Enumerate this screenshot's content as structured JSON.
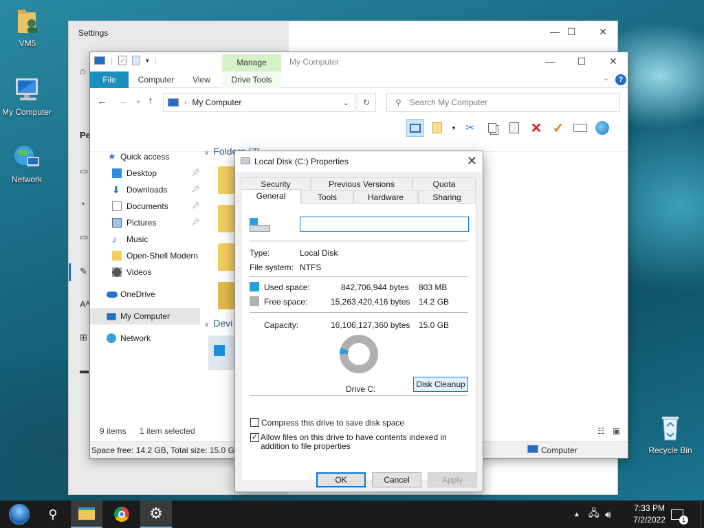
{
  "desktop": {
    "icons": [
      {
        "label": "VM5"
      },
      {
        "label": "My Computer"
      },
      {
        "label": "Network"
      },
      {
        "label": "Recycle Bin"
      }
    ]
  },
  "settings": {
    "title": "Settings",
    "partial_heading": "Pe"
  },
  "explorer": {
    "title": "My Computer",
    "manage_label": "Manage",
    "tabs": {
      "file": "File",
      "computer": "Computer",
      "view": "View",
      "drive_tools": "Drive Tools"
    },
    "address": "My Computer",
    "search_placeholder": "Search My Computer",
    "nav": {
      "quick_access": "Quick access",
      "items": [
        {
          "label": "Desktop"
        },
        {
          "label": "Downloads"
        },
        {
          "label": "Documents"
        },
        {
          "label": "Pictures"
        },
        {
          "label": "Music"
        },
        {
          "label": "Open-Shell Modern"
        },
        {
          "label": "Videos"
        }
      ],
      "onedrive": "OneDrive",
      "my_computer": "My Computer",
      "network": "Network"
    },
    "section_folders": "Folders (7)",
    "section_devices": "Devi",
    "status_items": "9 items",
    "status_selected": "1 item selected",
    "space_text": "Space free: 14.2 GB, Total size: 15.0 GB",
    "location_text": "Computer"
  },
  "dialog": {
    "title": "Local Disk (C:) Properties",
    "tabs_row1": [
      "Security",
      "Previous Versions",
      "Quota"
    ],
    "tabs_row2": [
      "General",
      "Tools",
      "Hardware",
      "Sharing"
    ],
    "name_value": "",
    "type_label": "Type:",
    "type_value": "Local Disk",
    "fs_label": "File system:",
    "fs_value": "NTFS",
    "used_label": "Used space:",
    "used_bytes": "842,706,944 bytes",
    "used_size": "803 MB",
    "free_label": "Free space:",
    "free_bytes": "15,263,420,416 bytes",
    "free_size": "14.2 GB",
    "capacity_label": "Capacity:",
    "capacity_bytes": "16,106,127,360 bytes",
    "capacity_size": "15.0 GB",
    "used_fraction": 0.0523,
    "used_color": "#26a0da",
    "free_color": "#b0b0b0",
    "drive_label": "Drive C:",
    "cleanup_label": "Disk Cleanup",
    "compress_label": "Compress this drive to save disk space",
    "compress_checked": false,
    "index_label": "Allow files on this drive to have contents indexed in addition to file properties",
    "index_checked": true,
    "ok_label": "OK",
    "cancel_label": "Cancel",
    "apply_label": "Apply"
  },
  "taskbar": {
    "time": "7:33 PM",
    "date": "7/2/2022",
    "notification_count": "1"
  }
}
